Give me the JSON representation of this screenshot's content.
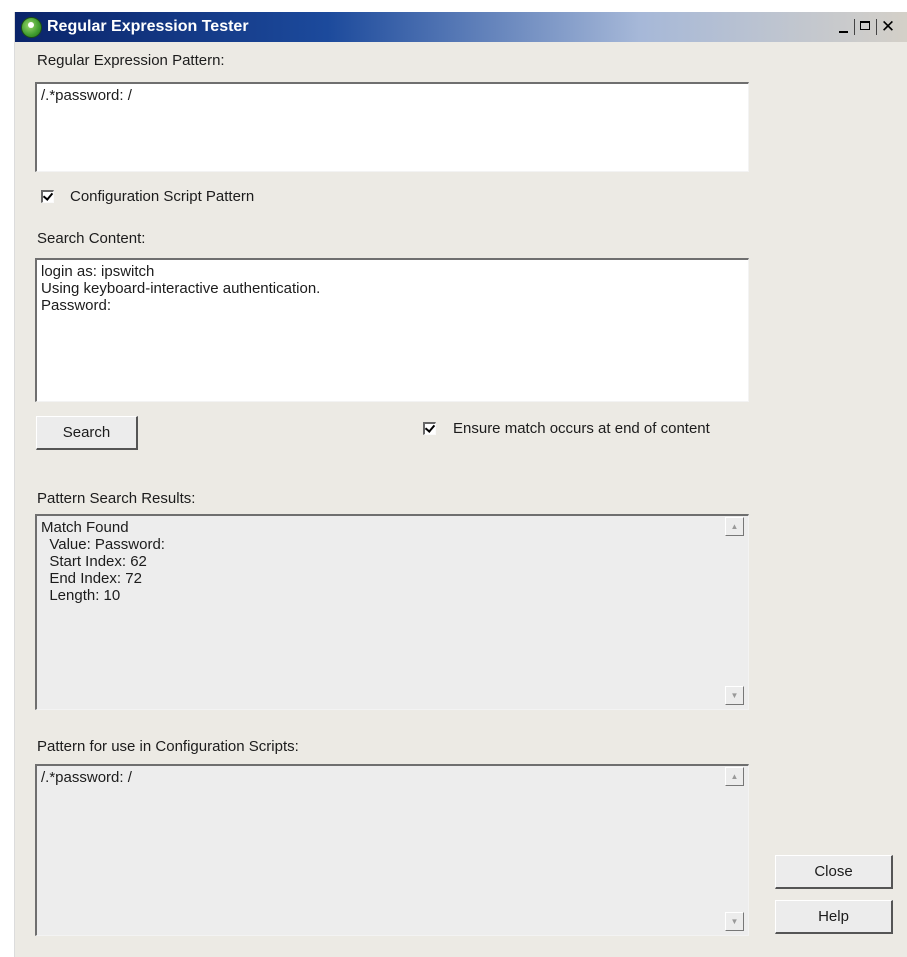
{
  "window": {
    "title": "Regular Expression Tester"
  },
  "pattern": {
    "label": "Regular Expression Pattern:",
    "value": "/.*password: /"
  },
  "config_checkbox": {
    "label": "Configuration Script Pattern",
    "checked": true
  },
  "search_content": {
    "label": "Search Content:",
    "value": "login as: ipswitch\nUsing keyboard-interactive authentication.\nPassword:"
  },
  "search_button": {
    "label": "Search"
  },
  "end_checkbox": {
    "label": "Ensure match occurs at end of content",
    "checked": true
  },
  "results": {
    "label": "Pattern Search Results:",
    "value": "Match Found\n  Value: Password:\n  Start Index: 62\n  End Index: 72\n  Length: 10"
  },
  "config_pattern": {
    "label": "Pattern for use in Configuration Scripts:",
    "value": "/.*password: /"
  },
  "close_button": {
    "label": "Close"
  },
  "help_button": {
    "label": "Help"
  },
  "colors": {
    "title_bar": "#0a246a",
    "dialog_bg": "#eceae4"
  }
}
